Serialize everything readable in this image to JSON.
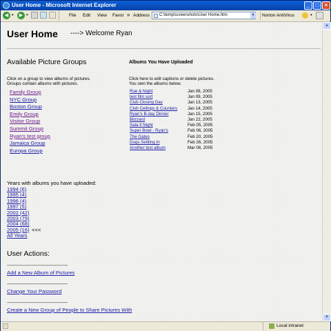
{
  "window": {
    "title": "User Home - Microsoft Internet Explorer"
  },
  "toolbar": {
    "menu": [
      "File",
      "Edit",
      "View",
      "Favor"
    ],
    "chevron": "»",
    "address_label": "Address",
    "address_value": "C:\\temp\\screenshots\\User Home.htm",
    "norton": "Norton AntiVirus"
  },
  "page": {
    "title": "User Home",
    "welcome": "----> Welcome Ryan",
    "groups_heading": "Available Picture Groups",
    "groups_help": [
      "Click on a group to view albums of pictures.",
      "Groups contain albums with pictures."
    ],
    "groups": [
      {
        "label": "Family Group",
        "visited": true
      },
      {
        "label": "NYC Group",
        "visited": false
      },
      {
        "label": "Boston Group",
        "visited": false
      },
      {
        "label": "Emily Group",
        "visited": true
      },
      {
        "label": "Visitor Group",
        "visited": true
      },
      {
        "label": "Summit Group",
        "visited": true
      },
      {
        "label": "Ryan's test group",
        "visited": true
      },
      {
        "label": "Jamaica Group",
        "visited": false
      },
      {
        "label": "Europa Group",
        "visited": false
      }
    ],
    "albums_heading": "Albums You Have Uploaded",
    "albums_help": [
      "Click here to edit captions or delete pictures.",
      "You own the albums below."
    ],
    "albums": [
      {
        "name": "Rue & Night",
        "date": "Jan 08, 2005"
      },
      {
        "name": "test film sort",
        "date": "Jan 09, 2005"
      },
      {
        "name": "Club Closing Day",
        "date": "Jan 13, 2005"
      },
      {
        "name": "Club Ceilings & Counters",
        "date": "Jan 14, 2005"
      },
      {
        "name": "Ryan's B-day Dinner",
        "date": "Jan 15, 2005"
      },
      {
        "name": "Blizzard",
        "date": "Jan 22, 2005"
      },
      {
        "name": "Sala II Night",
        "date": "Feb 05, 2005"
      },
      {
        "name": "Super Bowl - Ryan's",
        "date": "Feb 06, 2005"
      },
      {
        "name": "The Gates",
        "date": "Feb 20, 2005"
      },
      {
        "name": "Dogs Settling In",
        "date": "Feb 26, 2005"
      },
      {
        "name": "Another test album",
        "date": "Mar 06, 2005"
      }
    ],
    "years_label": "Years with albums you have uploaded:",
    "years": [
      "1994 (6)",
      "1995 (4)",
      "1996 (4)",
      "1997 (5)",
      "2002 (42)",
      "2003 (79)",
      "2004 (68)",
      "2005 (16)"
    ],
    "current_marker": "<<<",
    "all_years": "All Years",
    "actions_heading": "User Actions:",
    "separator": "------------------------------------------------",
    "actions": [
      "Add a New Album of Pictures",
      "Change Your Password",
      "Create a New Group of People to Share Pictures With"
    ]
  },
  "status": {
    "zone": "Local intranet"
  },
  "colors": {
    "link": "#1a1aa6",
    "visited": "#6a1a8a",
    "titlebar": "#0a5fd8"
  }
}
